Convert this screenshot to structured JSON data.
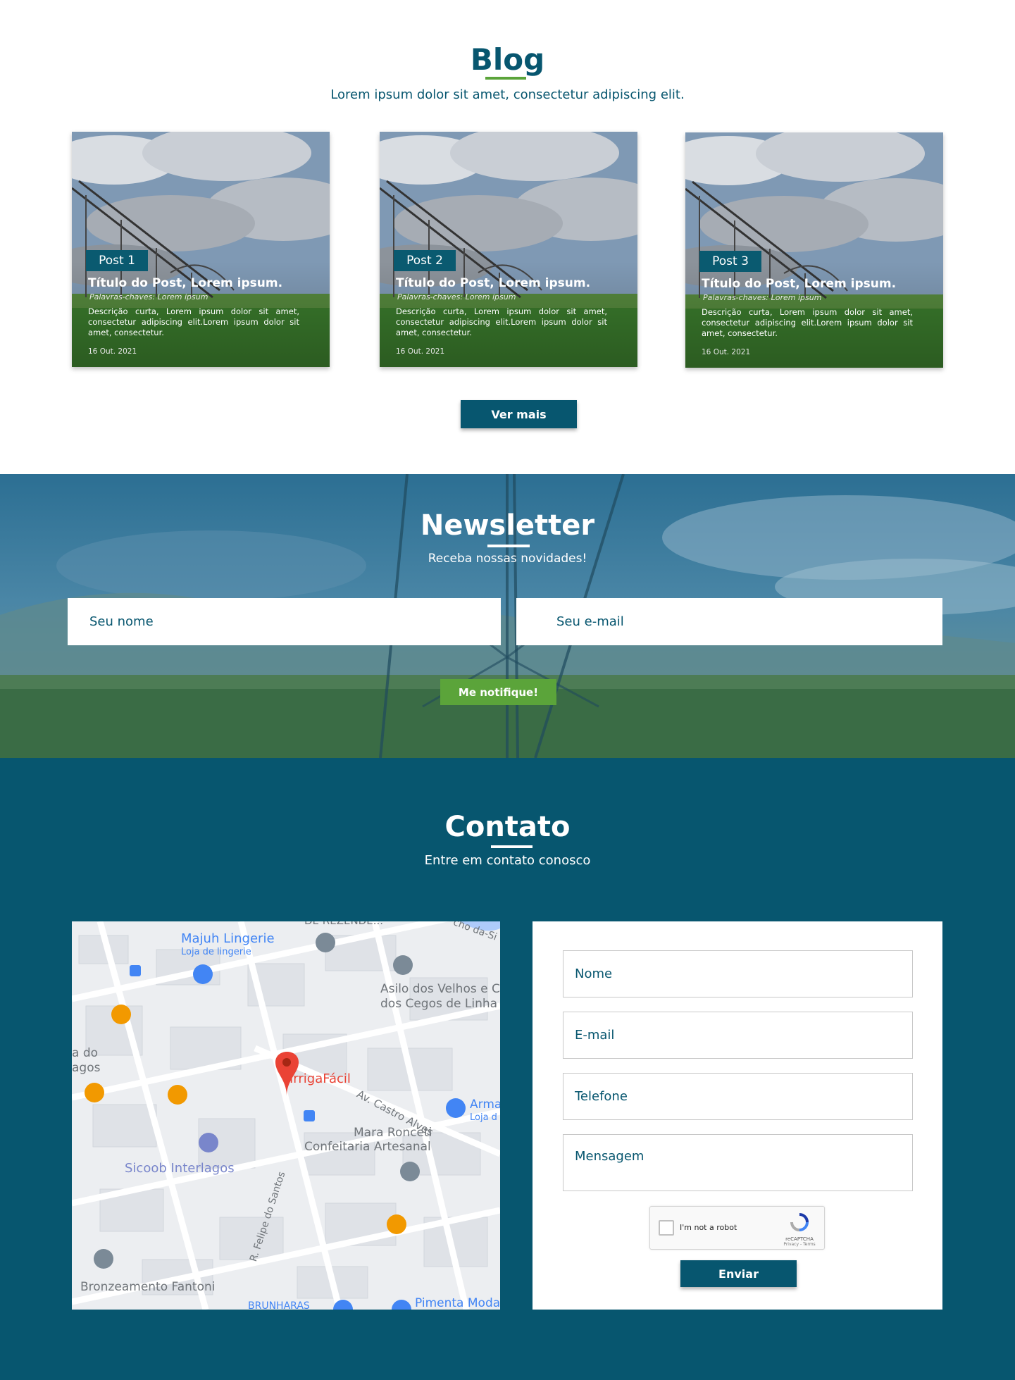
{
  "blog": {
    "title": "Blog",
    "subtitle": "Lorem ipsum dolor sit amet, consectetur adipiscing elit.",
    "posts": [
      {
        "tag": "Post 1",
        "title": "Título do Post, Lorem ipsum.",
        "keywords": "Palavras-chaves: Lorem ipsum",
        "description": "Descrição curta, Lorem ipsum dolor sit amet, consectetur adipiscing elit.Lorem ipsum dolor sit amet, consectetur.",
        "date": "16 Out. 2021"
      },
      {
        "tag": "Post 2",
        "title": "Título do Post, Lorem ipsum.",
        "keywords": "Palavras-chaves: Lorem ipsum",
        "description": "Descrição curta, Lorem ipsum dolor sit amet, consectetur adipiscing elit.Lorem ipsum dolor sit amet, consectetur.",
        "date": "16 Out. 2021"
      },
      {
        "tag": "Post 3",
        "title": "Título do Post, Lorem ipsum.",
        "keywords": "Palavras-chaves: Lorem ipsum",
        "description": "Descrição curta, Lorem ipsum dolor sit amet, consectetur adipiscing elit.Lorem ipsum dolor sit amet, consectetur.",
        "date": "16 Out. 2021"
      }
    ],
    "more_label": "Ver mais"
  },
  "newsletter": {
    "title": "Newsletter",
    "subtitle": "Receba nossas novidades!",
    "name_placeholder": "Seu nome",
    "email_placeholder": "Seu e-mail",
    "button_label": "Me notifique!"
  },
  "contato": {
    "title": "Contato",
    "subtitle": "Entre em contato conosco",
    "map": {
      "labels": {
        "majuh": "Majuh Lingerie",
        "majuh_sub": "Loja de lingerie",
        "asilo1": "Asilo dos Velhos e C",
        "asilo2": "dos Cegos de Linha",
        "irriga": "IrrigaFácil",
        "castro": "Av. Castro Alves",
        "arma": "Arma",
        "arma_sub": "Loja d",
        "mara1": "Mara Ronceti",
        "mara2": "Confeitaria Artesanal",
        "sicoob": "Sicoob Interlagos",
        "felipe": "R. Felipe do Santos",
        "bronze": "Bronzeamento Fantoni",
        "pimenta": "Pimenta Moda",
        "ado": "a do",
        "agos": "agos",
        "top_cut": "DE REZENDE...",
        "da_si": "cho da-Si",
        "brunharas": "BRUNHARAS"
      }
    },
    "form": {
      "nome": "Nome",
      "email": "E-mail",
      "telefone": "Telefone",
      "mensagem": "Mensagem",
      "captcha_label": "I'm not a robot",
      "captcha_brand": "reCAPTCHA",
      "captcha_terms": "Privacy - Terms",
      "send_label": "Enviar"
    }
  },
  "colors": {
    "primary": "#07566f",
    "accent": "#5ba43a"
  }
}
